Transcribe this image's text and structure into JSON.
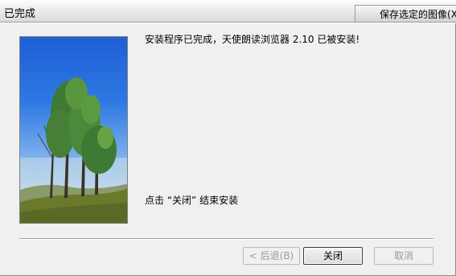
{
  "window": {
    "title": "已完成"
  },
  "overlay_tab": {
    "label": "保存选定的图像(X"
  },
  "content": {
    "main_message": "安装程序已完成，天使朗读浏览器 2.10 已被安装!",
    "finish_hint": "点击 “关闭” 结束安装"
  },
  "buttons": {
    "back_label": "< 后退(B)",
    "close_label": "关闭",
    "cancel_label": "取消"
  },
  "colors": {
    "sky_top": "#1e5fd6",
    "grass": "#6a7a2a",
    "tree": "#3f7a34"
  }
}
